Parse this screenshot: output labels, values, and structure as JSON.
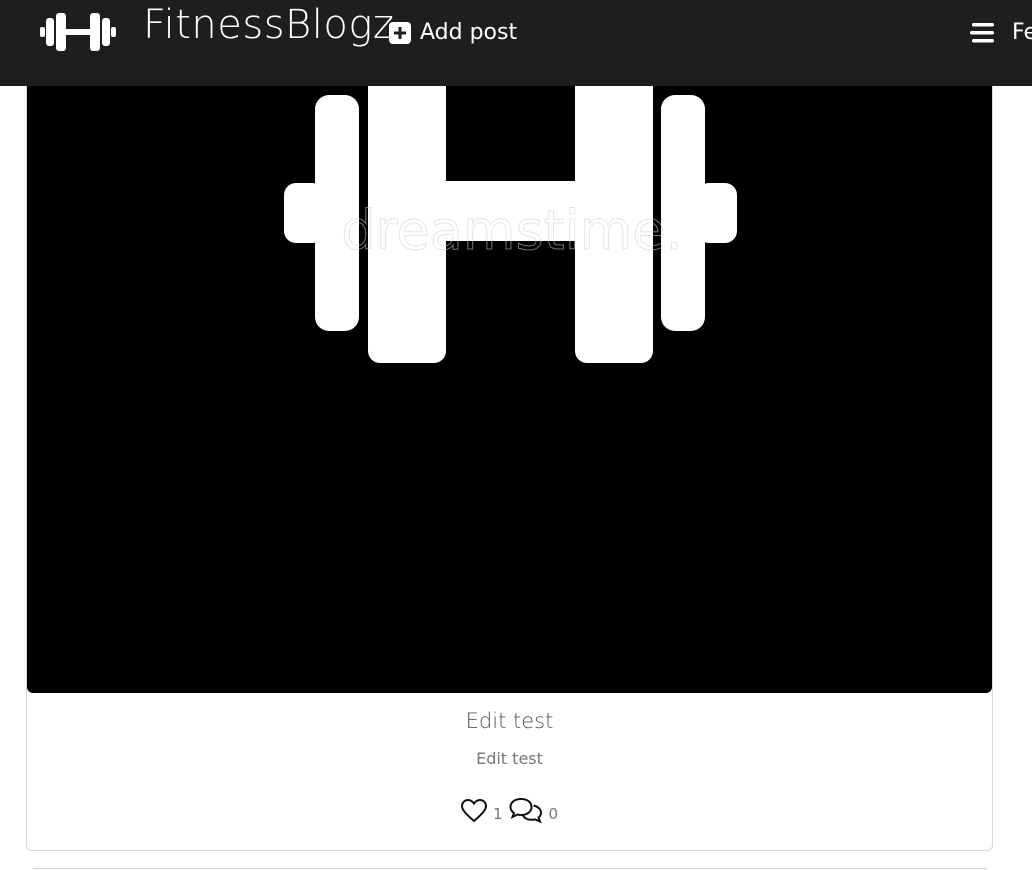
{
  "navbar": {
    "brand_name": "FitnessBlogz",
    "brand_icon": "dumbbell-icon",
    "add_post_label": "Add post",
    "add_post_icon": "plus-square-icon",
    "menu_label": "Fe",
    "menu_icon": "bars-icon"
  },
  "post": {
    "image_alt": "dumbbell image",
    "image_watermark": "dreamstime.",
    "title": "Edit test",
    "body": "Edit test",
    "like_icon": "heart-icon",
    "like_count": "1",
    "comment_icon": "comments-icon",
    "comment_count": "0"
  },
  "colors": {
    "navbar_bg": "#1e1e1e",
    "image_bg": "#000000",
    "card_border": "#d9d9d9"
  }
}
